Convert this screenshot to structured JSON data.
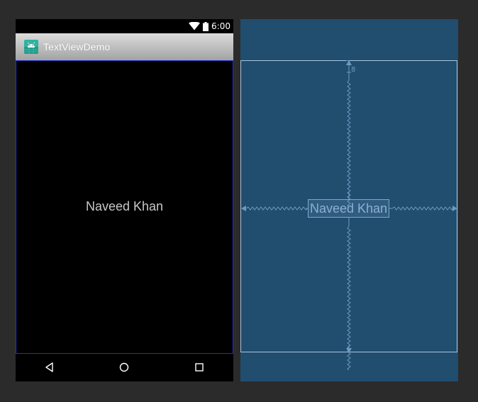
{
  "status_bar": {
    "time": "6:00"
  },
  "app_bar": {
    "title": "TextViewDemo",
    "icon": "android-icon"
  },
  "content": {
    "text_view": "Naveed Khan"
  },
  "nav_bar": {
    "back_icon": "back-triangle-icon",
    "home_icon": "home-circle-icon",
    "recents_icon": "recents-square-icon"
  },
  "blueprint": {
    "text_view": "Naveed Khan",
    "top_margin": "8"
  },
  "colors": {
    "canvas": "#2b2b2b",
    "blueprint_bg": "#214d6f",
    "blueprint_line": "#a9c6dc",
    "constraint": "#6e9ac0",
    "selection_border": "#2034c8",
    "app_icon": "#2fb3a0"
  }
}
